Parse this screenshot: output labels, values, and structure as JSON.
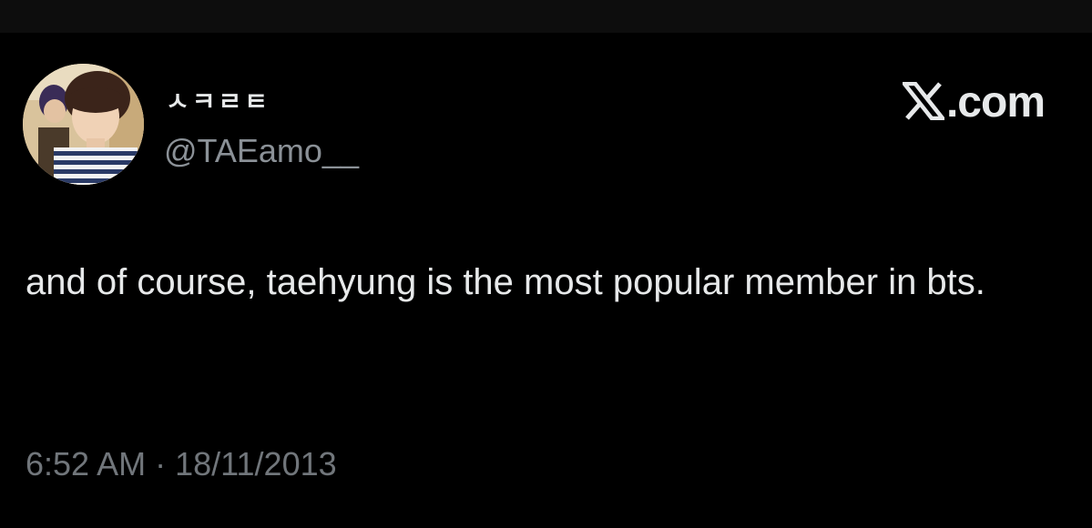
{
  "tweet": {
    "display_name": "ㅅㅋㄹㅌ",
    "handle": "@TAEamo__",
    "avatar_icon": "profile-photo",
    "text": "and of course, taehyung is the most popular member in bts.",
    "time": "6:52 AM",
    "separator": "·",
    "date": "18/11/2013"
  },
  "brand": {
    "icon": "x-logo-icon",
    "label": ".com"
  },
  "colors": {
    "background": "#000000",
    "text_primary": "#e7e9ea",
    "text_secondary": "#71767b"
  }
}
